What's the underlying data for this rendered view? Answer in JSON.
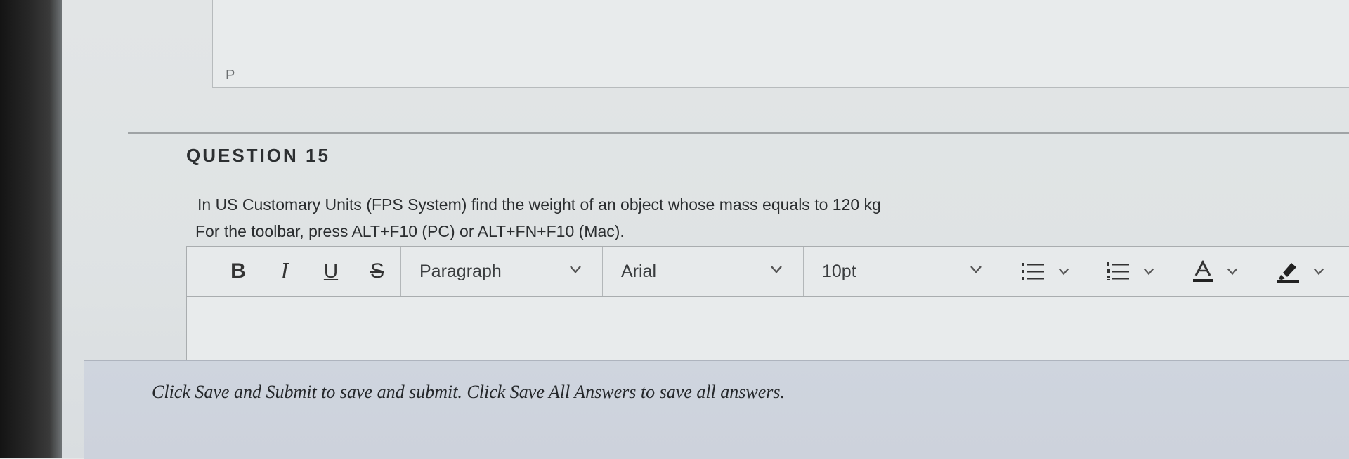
{
  "previous_editor": {
    "path_label": "P"
  },
  "question": {
    "title": "QUESTION 15",
    "text": "In US Customary Units (FPS System) find the weight of an object whose mass equals to 120 kg",
    "toolbar_hint": "For the toolbar, press ALT+F10 (PC) or ALT+FN+F10 (Mac)."
  },
  "toolbar": {
    "bold_label": "B",
    "italic_label": "I",
    "underline_label": "U",
    "strike_label": "S",
    "block_format": "Paragraph",
    "font_family": "Arial",
    "font_size": "10pt",
    "icons": [
      "bullet-list-icon",
      "numbered-list-icon",
      "text-color-icon",
      "highlight-icon"
    ]
  },
  "footer": {
    "instructions": "Click Save and Submit to save and submit. Click Save All Answers to save all answers."
  },
  "colors": {
    "text": "#2a2d2f",
    "footer_bg": "#cfd5de"
  }
}
